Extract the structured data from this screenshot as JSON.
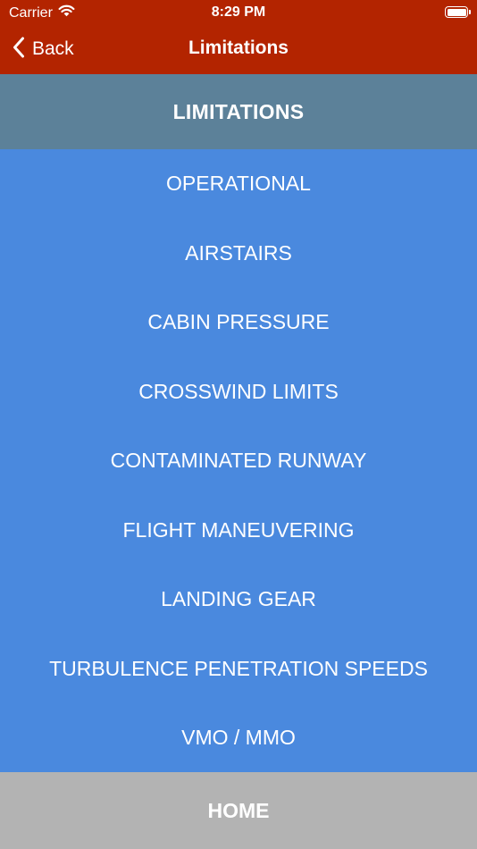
{
  "status_bar": {
    "carrier": "Carrier",
    "time": "8:29 PM",
    "icons": [
      "wifi-icon",
      "battery-icon"
    ]
  },
  "nav": {
    "back_label": "Back",
    "back_icon": "chevron-left-icon",
    "title": "Limitations"
  },
  "section": {
    "title": "LIMITATIONS"
  },
  "menu": {
    "items": [
      {
        "label": "OPERATIONAL"
      },
      {
        "label": "AIRSTAIRS"
      },
      {
        "label": "CABIN PRESSURE"
      },
      {
        "label": "CROSSWIND LIMITS"
      },
      {
        "label": "CONTAMINATED RUNWAY"
      },
      {
        "label": "FLIGHT MANEUVERING"
      },
      {
        "label": "LANDING GEAR"
      },
      {
        "label": "TURBULENCE PENETRATION SPEEDS"
      },
      {
        "label": "VMO / MMO"
      }
    ]
  },
  "footer": {
    "home_label": "HOME"
  },
  "colors": {
    "nav_background": "#b32400",
    "section_header": "#5c8199",
    "menu_background": "#4a89de",
    "home_background": "#b3b3b3",
    "text": "#ffffff"
  }
}
